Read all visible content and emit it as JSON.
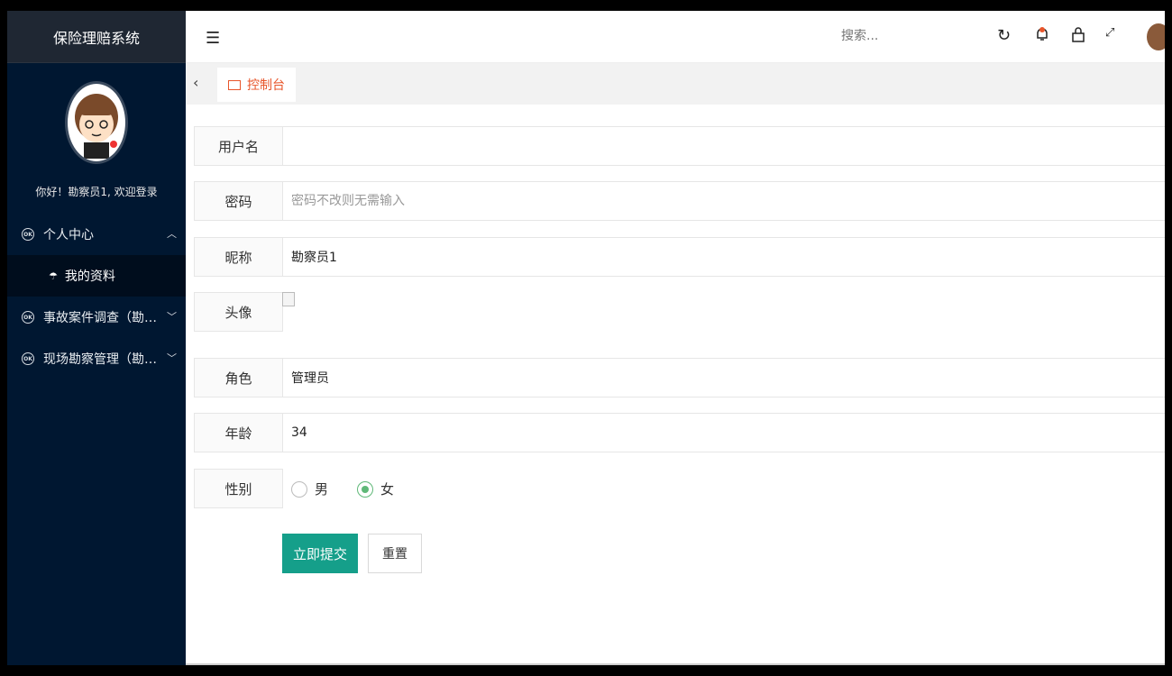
{
  "app": {
    "title": "保险理赔系统"
  },
  "sidebar": {
    "welcome": "你好！勘察员1, 欢迎登录",
    "items": [
      {
        "label": "个人中心",
        "icon": "ok-icon",
        "expanded": true,
        "children": [
          {
            "label": "我的资料"
          }
        ]
      },
      {
        "label": "事故案件调查（勘察...",
        "icon": "ok-icon",
        "expanded": false
      },
      {
        "label": "现场勘察管理（勘察...",
        "icon": "ok-icon",
        "expanded": false
      }
    ]
  },
  "header": {
    "search_placeholder": "搜索...",
    "icons": [
      "refresh-icon",
      "bell-icon",
      "lock-icon",
      "fullscreen-icon"
    ]
  },
  "tabs": [
    {
      "label": "控制台",
      "active": true
    }
  ],
  "form": {
    "username_label": "用户名",
    "username_value": "",
    "password_label": "密码",
    "password_placeholder": "密码不改则无需输入",
    "nickname_label": "昵称",
    "nickname_value": "勘察员1",
    "avatar_label": "头像",
    "role_label": "角色",
    "role_value": "管理员",
    "age_label": "年龄",
    "age_value": "34",
    "gender_label": "性别",
    "gender_options": [
      "男",
      "女"
    ],
    "gender_selected": "女",
    "submit_label": "立即提交",
    "reset_label": "重置"
  },
  "colors": {
    "sidebar_bg": "#001731",
    "accent": "#159f8a",
    "tab_active": "#e8552a",
    "radio_checked": "#5fb878"
  }
}
